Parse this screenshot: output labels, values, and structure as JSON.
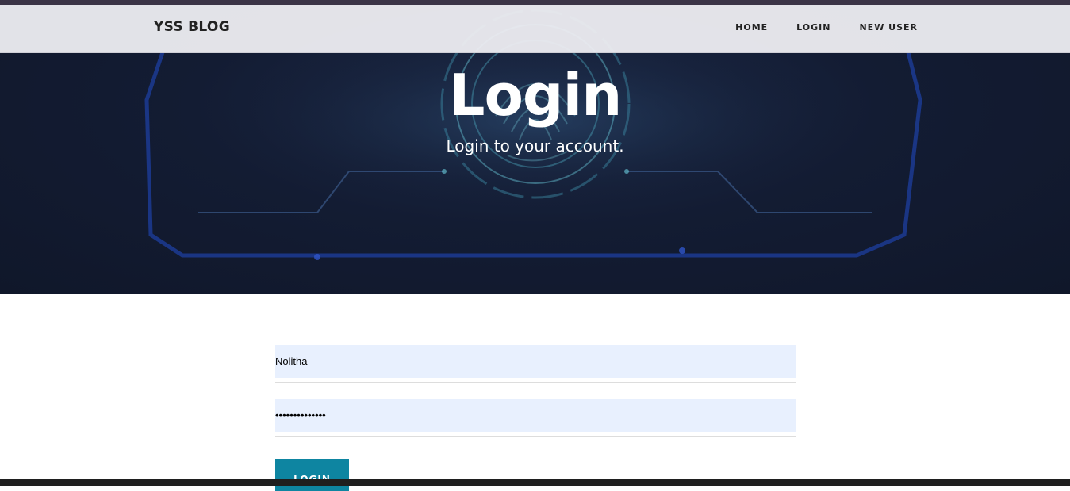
{
  "navbar": {
    "brand": "YSS BLOG",
    "links": [
      {
        "label": "HOME"
      },
      {
        "label": "LOGIN"
      },
      {
        "label": "NEW USER"
      }
    ]
  },
  "hero": {
    "title": "Login",
    "subtitle": "Login to your account."
  },
  "form": {
    "username_value": "Nolitha",
    "password_value": "••••••••••••••",
    "submit_label": "LOGIN"
  },
  "colors": {
    "accent": "#0e85a1",
    "field_bg": "#e8f0fe",
    "hero_bg": "#131c33"
  }
}
